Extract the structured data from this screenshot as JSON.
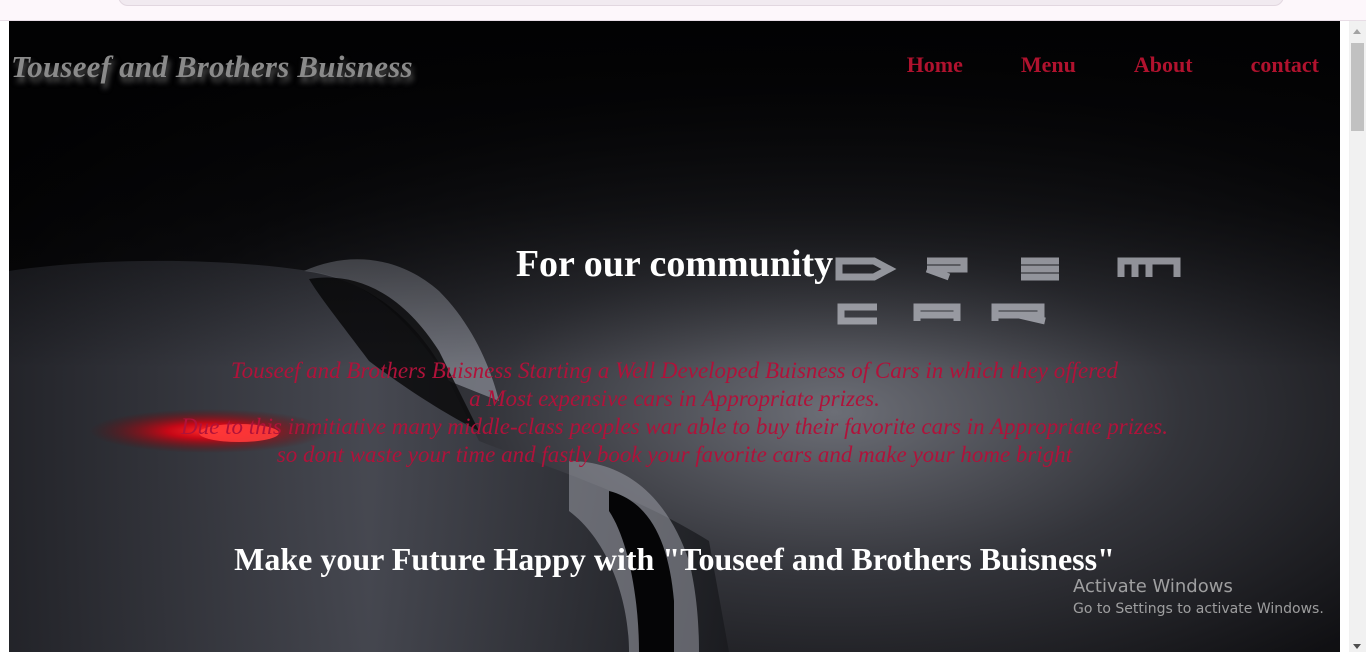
{
  "site": {
    "title": "Touseef and Brothers Buisness"
  },
  "nav": {
    "items": [
      {
        "label": "Home"
      },
      {
        "label": "Menu"
      },
      {
        "label": "About"
      },
      {
        "label": "contact"
      }
    ]
  },
  "hero": {
    "headline": "For our community",
    "background_text": "DREAM CAR",
    "description_lines": [
      "Touseef and Brothers Buisness Starting a Well Developed Buisness of Cars in which they offered",
      "a Most expensive cars in Appropriate prizes.",
      "Due to this inmitiative many middle-class peoples war able to buy their favorite cars in Appropriate prizes.",
      "so dont waste your time and fastly book your favorite cars and make your home bright"
    ],
    "tagline": "Make your Future Happy with \"Touseef and Brothers Buisness\""
  },
  "watermark": {
    "title": "Activate Windows",
    "subtitle": "Go to Settings to activate Windows."
  },
  "colors": {
    "nav_link": "#b0122e",
    "description": "#b0123a",
    "logo": "#8a8a8a",
    "hero_bg": "#020203"
  }
}
